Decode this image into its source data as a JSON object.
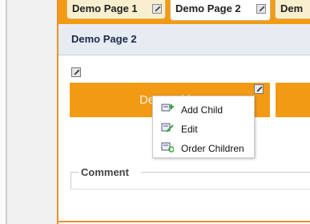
{
  "tabs": [
    {
      "label": "Demo Page 1",
      "active": false
    },
    {
      "label": "Demo Page 2",
      "active": true
    },
    {
      "label": "Dem",
      "active": false
    }
  ],
  "header": {
    "title": "Demo Page 2"
  },
  "block": {
    "title": "Demo Title"
  },
  "context_menu": {
    "items": [
      {
        "label": "Add Child",
        "icon": "add-child-icon"
      },
      {
        "label": "Edit",
        "icon": "edit-icon"
      },
      {
        "label": "Order Children",
        "icon": "order-children-icon"
      }
    ]
  },
  "comment": {
    "legend": "Comment"
  },
  "colors": {
    "accent": "#f39a15",
    "header_bg": "#e6ecf2"
  }
}
